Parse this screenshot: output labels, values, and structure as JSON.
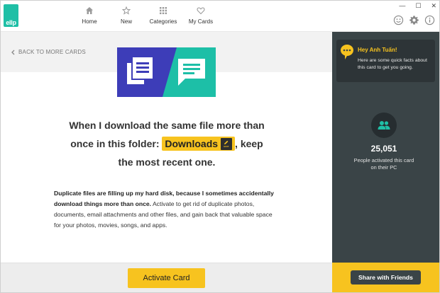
{
  "app": {
    "logo_text": "ellp"
  },
  "window_controls": {
    "minimize": "—",
    "maximize": "☐",
    "close": "✕"
  },
  "nav": [
    {
      "label": "Home",
      "icon": "home-icon"
    },
    {
      "label": "New",
      "icon": "star-icon"
    },
    {
      "label": "Categories",
      "icon": "grid-icon"
    },
    {
      "label": "My Cards",
      "icon": "heart-icon"
    }
  ],
  "top_icons": [
    "smiley-icon",
    "gear-icon",
    "info-icon"
  ],
  "back_link": {
    "label": "BACK TO MORE CARDS"
  },
  "card": {
    "headline_part1": "When I download the same file more than",
    "headline_part2": "once in this folder:",
    "folder_name": "Downloads",
    "edit_label": "EDIT",
    "headline_part3": ", keep",
    "headline_part4": "the most recent one.",
    "desc_bold": "Duplicate files are filling up my hard disk, because I sometimes accidentally download things more than once.",
    "desc_rest": " Activate to get rid of duplicate photos, documents, email attachments and other files, and gain back that valuable space for your photos, movies, songs, and apps."
  },
  "activate_button": "Activate Card",
  "sidebar": {
    "tip_title": "Hey Anh Tuấn!",
    "tip_body": "Here are some quick facts about this card to get you going.",
    "count": "25,051",
    "count_label": "People activated this card on their PC",
    "share_button": "Share with Friends"
  },
  "colors": {
    "accent_yellow": "#f7c31f",
    "brand_teal": "#1fbfa6",
    "banner_blue": "#3d3db8",
    "sidebar_dark": "#3a4447"
  }
}
